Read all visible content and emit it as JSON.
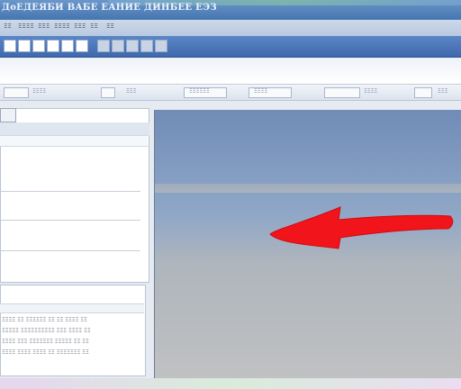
{
  "window": {
    "title": "ДоЕДЕЯБИ ВАБЕ ЕАНИЕ ДИНБЕЕ ЕЭЗ"
  },
  "menu": {
    "items": [
      "ΞΞ",
      "ΞΞΞΞ",
      "ΞΞΞ",
      "ΞΞΞΞ",
      "ΞΞΞ",
      "ΞΞ",
      "ΞΞ"
    ]
  },
  "toolbar": {
    "buttons": [
      "t1",
      "t2",
      "t3",
      "t4",
      "t5",
      "t6",
      "t7",
      "t8",
      "t9",
      "t10",
      "t11"
    ]
  },
  "toolbar2": {
    "items": [
      {
        "label": "ΞΞΞΞ"
      },
      {
        "label": "ΞΞΞ"
      },
      {
        "label": "ΞΞΞΞΞΞ"
      },
      {
        "label": "ΞΞΞΞ"
      },
      {
        "label": "ΞΞΞΞ"
      },
      {
        "label": "ΞΞΞ"
      }
    ]
  },
  "left_panel": {
    "log_lines": [
      "ΞΞΞΞ ΞΞ ΞΞΞΞΞΞ ΞΞ ΞΞ ΞΞΞΞ ΞΞ",
      "ΞΞΞΞΞ ΞΞΞΞΞΞΞΞΞΞ ΞΞΞ ΞΞΞΞ ΞΞ",
      "ΞΞΞΞ ΞΞΞ ΞΞΞΞΞΞΞ ΞΞΞΞΞ ΞΞ ΞΞ",
      "ΞΞΞΞ ΞΞΞΞ ΞΞΞΞ ΞΞ ΞΞΞΞΞΞΞ ΞΞ"
    ]
  },
  "viewport": {
    "annotation": "red-arrow-left",
    "arrow_color": "#f2141b"
  }
}
